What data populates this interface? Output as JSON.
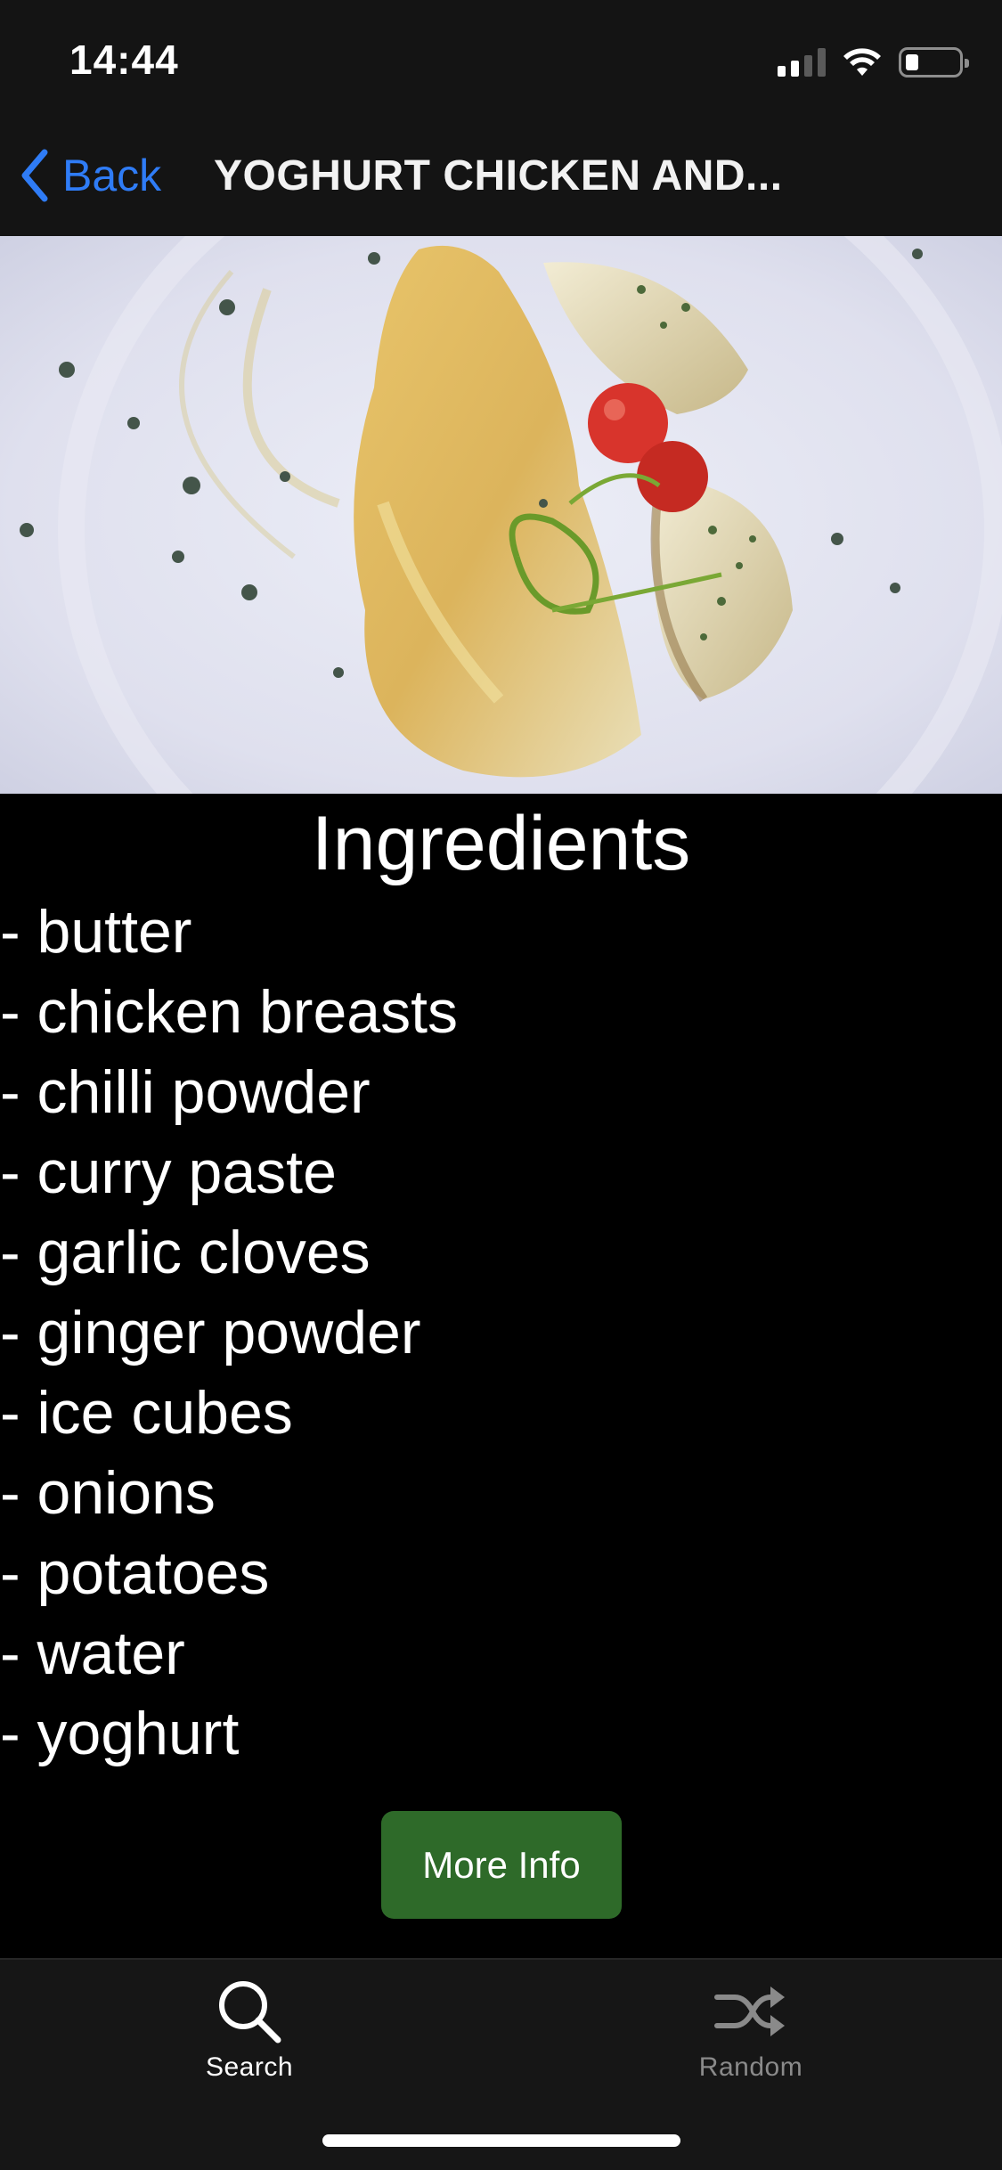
{
  "status_bar": {
    "time": "14:44",
    "icons": [
      "cellular-signal-icon",
      "wifi-icon",
      "battery-icon"
    ],
    "battery_level": 0.2
  },
  "nav": {
    "back_label": "Back",
    "title": "YOGHURT CHICKEN AND...",
    "back_icon": "chevron-left-icon"
  },
  "hero": {
    "image": "photo of chicken breast with yoghurt crust, potato wedges, cherry tomatoes and chive garnish on a white plate"
  },
  "content": {
    "section_title": "Ingredients",
    "ingredients": [
      "- butter",
      "- chicken breasts",
      "- chilli powder",
      "- curry paste",
      "- garlic cloves",
      "- ginger powder",
      "- ice cubes",
      "- onions",
      "- potatoes",
      "- water",
      "- yoghurt"
    ],
    "more_info_label": "More Info"
  },
  "tab_bar": {
    "tabs": [
      {
        "label": "Search",
        "icon": "search-icon",
        "active": true
      },
      {
        "label": "Random",
        "icon": "shuffle-icon",
        "active": false
      }
    ]
  },
  "colors": {
    "accent": "#2f7cf6",
    "button_green": "#2e6a29",
    "background": "#000000",
    "bar_background": "#141414"
  }
}
